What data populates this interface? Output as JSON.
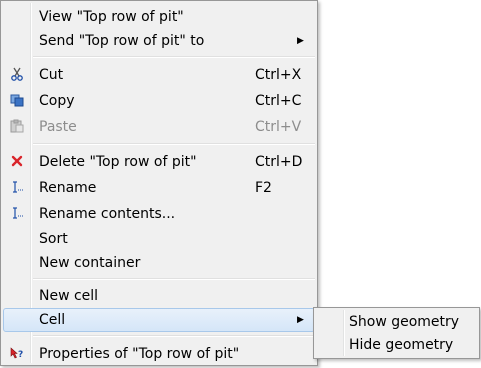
{
  "menu": {
    "view_label": "View \"Top row of pit\"",
    "send_label": "Send \"Top row of pit\" to",
    "cut_label": "Cut",
    "cut_shortcut": "Ctrl+X",
    "copy_label": "Copy",
    "copy_shortcut": "Ctrl+C",
    "paste_label": "Paste",
    "paste_shortcut": "Ctrl+V",
    "delete_label": "Delete \"Top row of pit\"",
    "delete_shortcut": "Ctrl+D",
    "rename_label": "Rename",
    "rename_shortcut": "F2",
    "rename_contents_label": "Rename contents...",
    "sort_label": "Sort",
    "new_container_label": "New container",
    "new_cell_label": "New cell",
    "cell_label": "Cell",
    "properties_label": "Properties of \"Top row of pit\""
  },
  "submenu": {
    "show_geometry_label": "Show geometry",
    "hide_geometry_label": "Hide geometry"
  },
  "icons": {
    "cut": "scissors-icon",
    "copy": "copy-icon",
    "paste": "paste-icon",
    "delete": "delete-x-icon",
    "rename": "rename-cursor-icon",
    "rename_contents": "rename-cursor-icon",
    "properties": "whats-this-icon"
  },
  "colors": {
    "menu_bg": "#f0f0f0",
    "selection_bg": "#d5e6f8",
    "selection_border": "#a8c8ea",
    "disabled_text": "#8d8d8d",
    "delete_icon": "#d9252b"
  }
}
